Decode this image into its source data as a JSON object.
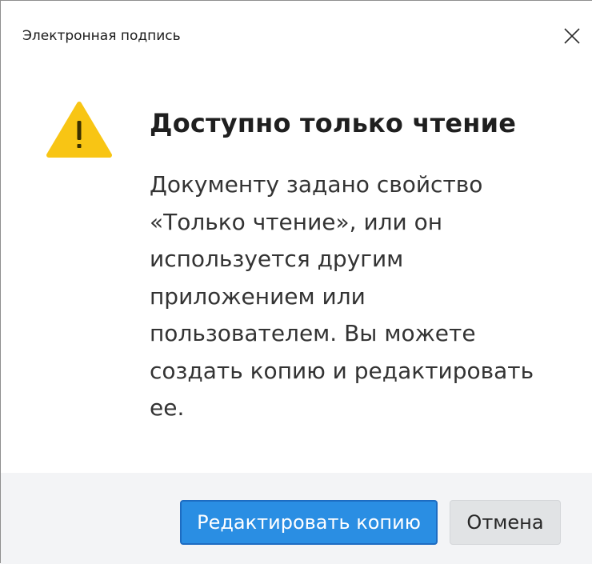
{
  "window": {
    "title": "Электронная подпись",
    "close_icon": "close-icon"
  },
  "dialog": {
    "icon": "warning-triangle-icon",
    "icon_color": "#f8c514",
    "heading": "Доступно только чтение",
    "message_lines": [
      "Документу задано свойство",
      "«Только чтение», или он",
      "используется другим",
      "приложением или",
      "пользователем. Вы можете",
      "создать копию и редактировать",
      "ее."
    ]
  },
  "footer": {
    "primary_button": "Редактировать копию",
    "secondary_button": "Отмена",
    "primary_color": "#2a8ee3"
  }
}
